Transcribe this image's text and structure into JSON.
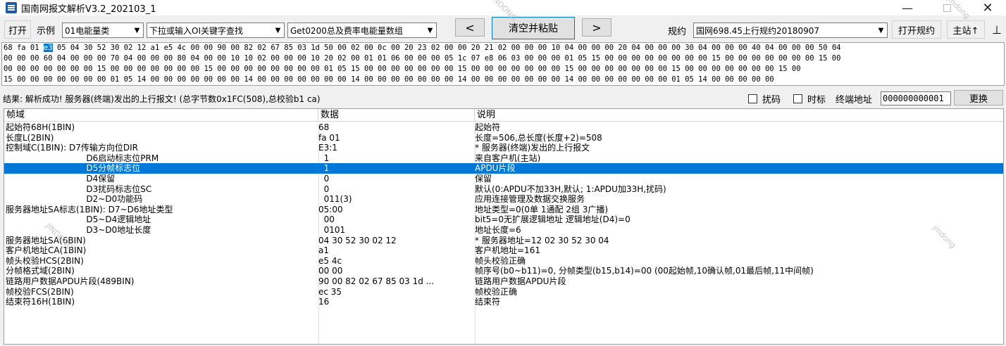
{
  "window": {
    "title": "国南网报文解析V3.2_202103_1",
    "minimize": "—",
    "close": "✕"
  },
  "toolbar": {
    "open": "打开",
    "example_label": "示例",
    "example_value": "01电能量类",
    "search_value": "下拉或输入OI关键字查找",
    "get_value": "Get0200总及费率电能量数组",
    "prev": "<",
    "clear_paste": "清空并粘贴",
    "next": ">",
    "protocol_label": "规约",
    "protocol_value": "国网698.45上行规约20180907",
    "open_protocol": "打开规约",
    "master": "主站↑",
    "extra": "⊥"
  },
  "hex": {
    "line1_pre": "68 fa 01 ",
    "line1_sel": "e3",
    "line1_post": " 05 04 30 52 30 02 12 a1 e5 4c 00 00 90 00 82 02 67 85 03 1d 50 00 02 00 0c 00 20 23 02 00 00 20 21 02 00 00 00 10 04 00 00 00 20 04 00 00 00 30 04 00 00 00 40 04 00 00 00 50 04",
    "line2": "00 00 00 60 04 00 00 00 70 04 00 00 00 80 04 00 00 10 10 02 00 00 00 10 20 02 00 01 01 06 00 00 00 05 1c 07 e8 06 03 00 00 00 01 05 15 00 00 00 00 00 00 00 00 15 00 00 00 00 00 00 00 15 00",
    "line3": "00 00 00 00 00 00 00 15 00 00 00 00 00 00 00 15 00 00 00 00 00 00 00 00 01 05 15 00 00 00 00 00 00 00 15 00 00 00 00 00 00 00 15 00 00 00 00 00 00 00 15 00 00 00 00 00 00 00 15 00",
    "line4": "15 00 00 00 00 00 00 00 01 05 14 00 00 00 00 00 00 00 14 00 00 00 00 00 00 00 14 00 00 00 00 00 00 00 14 00 00 00 00 00 00 00 14 00 00 00 00 00 00 00 01 05 14 00 00 00 00 00"
  },
  "result": {
    "text": "结果: 解析成功! 服务器(终端)发出的上行报文! (总字节数0x1FC(508),总校验b1 ca)",
    "scramble_label": "扰码",
    "timestamp_label": "时标",
    "terminal_addr_label": "终端地址",
    "terminal_addr_value": "000000000001",
    "replace": "更换"
  },
  "table": {
    "headers": [
      "帧域",
      "数据",
      "说明"
    ],
    "rows": [
      {
        "field": "起始符68H(1BIN)",
        "data": "68",
        "desc": "起始符"
      },
      {
        "field": "长度L(2BIN)",
        "data": "fa 01",
        "desc": "长度=506,总长度(长度+2)=508"
      },
      {
        "field": "控制域C(1BIN): D7传输方向位DIR",
        "data": "E3:1",
        "desc": "* 服务器(终端)发出的上行报文"
      },
      {
        "field": "                              D6启动标志位PRM",
        "data": "  1",
        "desc": "来自客户机(主站)"
      },
      {
        "field": "                              D5分帧标志位",
        "data": "  1",
        "desc": "APDU片段"
      },
      {
        "field": "                              D4保留",
        "data": "  0",
        "desc": "保留"
      },
      {
        "field": "                              D3扰码标志位SC",
        "data": "  0",
        "desc": "默认(0:APDU不加33H,默认; 1:APDU加33H,扰码)"
      },
      {
        "field": "                              D2~D0功能码",
        "data": "  011(3)",
        "desc": "应用连接管理及数据交换服务"
      },
      {
        "field": "服务器地址SA标志(1BIN): D7~D6地址类型",
        "data": "05:00",
        "desc": "地址类型=0(0单 1通配 2组 3广播)"
      },
      {
        "field": "                              D5~D4逻辑地址",
        "data": "  00",
        "desc": "bit5=0无扩展逻辑地址 逻辑地址(D4)=0"
      },
      {
        "field": "                              D3~D0地址长度",
        "data": "  0101",
        "desc": "地址长度=6"
      },
      {
        "field": "服务器地址SA(6BIN)",
        "data": "04 30 52 30 02 12",
        "desc": "* 服务器地址=12 02 30 52 30 04"
      },
      {
        "field": "客户机地址CA(1BIN)",
        "data": "a1",
        "desc": "客户机地址=161"
      },
      {
        "field": "帧头校验HCS(2BIN)",
        "data": "e5 4c",
        "desc": "帧头校验正确"
      },
      {
        "field": "分帧格式域(2BIN)",
        "data": "00 00",
        "desc": "帧序号(b0~b11)=0, 分帧类型(b15,b14)=00 (00起始帧,10确认帧,01最后帧,11中间帧)"
      },
      {
        "field": "链路用户数据APDU片段(489BIN)",
        "data": "90 00 82 02 67 85 03 1d ...",
        "desc": "链路用户数据APDU片段"
      },
      {
        "field": "帧校验FCS(2BIN)",
        "data": "ec 35",
        "desc": "帧校验正确"
      },
      {
        "field": "结束符16H(1BIN)",
        "data": "16",
        "desc": "结束符"
      }
    ],
    "selected_index": 4
  },
  "watermark": [
    "JINDONG",
    "jindong",
    "JINDONG",
    "jindong"
  ]
}
